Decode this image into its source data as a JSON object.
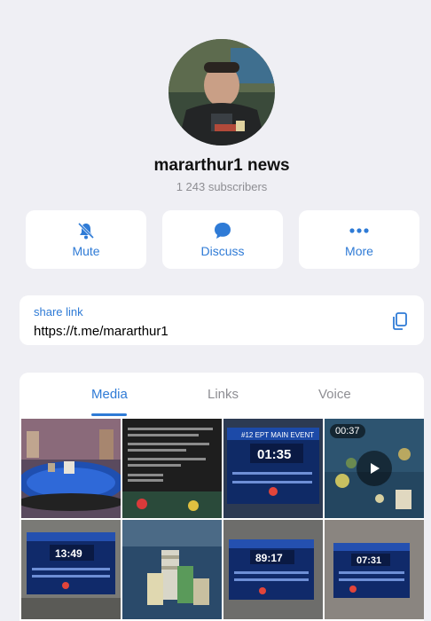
{
  "channel": {
    "name": "mararthur1 news",
    "subscribers": "1 243 subscribers"
  },
  "actions": [
    {
      "label": "Mute",
      "icon": "bell-slash-icon"
    },
    {
      "label": "Discuss",
      "icon": "chat-bubble-icon"
    },
    {
      "label": "More",
      "icon": "ellipsis-icon"
    }
  ],
  "share": {
    "caption": "share link",
    "url": "https://t.me/mararthur1",
    "icon": "copy-icon"
  },
  "tabs": [
    {
      "label": "Media",
      "active": true
    },
    {
      "label": "Links",
      "active": false
    },
    {
      "label": "Voice",
      "active": false
    }
  ],
  "media": {
    "video_duration": "00:37",
    "board1_time": "01:35",
    "board1_header": "#12 EPT MAIN EVENT",
    "board2_time": "13:49",
    "board3_time": "89:17",
    "board4_time": "07:31"
  },
  "colors": {
    "accent": "#2f7bd6",
    "background": "#efeff4",
    "muted": "#8e8e93"
  }
}
